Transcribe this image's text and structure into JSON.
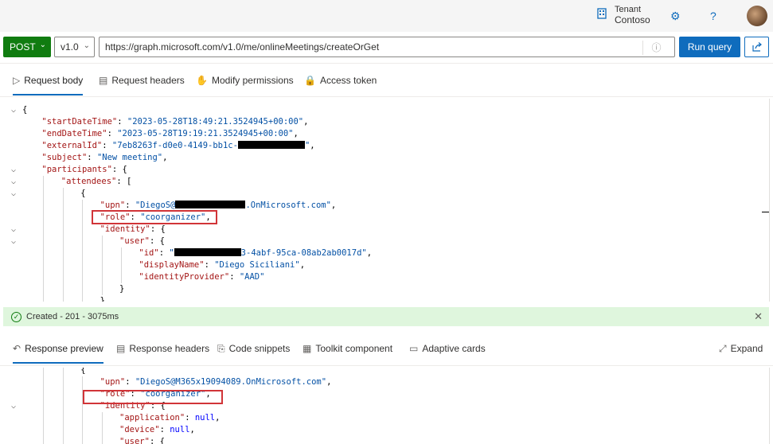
{
  "header": {
    "tenant_label": "Tenant",
    "tenant_name": "Contoso",
    "icons": [
      "building-icon",
      "gear-icon",
      "help-icon",
      "avatar"
    ]
  },
  "request": {
    "method": "POST",
    "version": "v1.0",
    "url": "https://graph.microsoft.com/v1.0/me/onlineMeetings/createOrGet",
    "run_label": "Run query"
  },
  "request_tabs": [
    {
      "label": "Request body",
      "icon": "send-icon",
      "active": true
    },
    {
      "label": "Request headers",
      "icon": "document-icon",
      "active": false
    },
    {
      "label": "Modify permissions",
      "icon": "hand-icon",
      "active": false
    },
    {
      "label": "Access token",
      "icon": "lock-icon",
      "active": false
    }
  ],
  "request_body": [
    {
      "indent": 0,
      "fold": true,
      "parts": [
        [
          "p",
          "{"
        ]
      ]
    },
    {
      "indent": 1,
      "fold": false,
      "parts": [
        [
          "k",
          "\"startDateTime\""
        ],
        [
          "p",
          ": "
        ],
        [
          "s",
          "\"2023-05-28T18:49:21.3524945+00:00\""
        ],
        [
          "p",
          ","
        ]
      ]
    },
    {
      "indent": 1,
      "fold": false,
      "parts": [
        [
          "k",
          "\"endDateTime\""
        ],
        [
          "p",
          ": "
        ],
        [
          "s",
          "\"2023-05-28T19:19:21.3524945+00:00\""
        ],
        [
          "p",
          ","
        ]
      ]
    },
    {
      "indent": 1,
      "fold": false,
      "parts": [
        [
          "k",
          "\"externalId\""
        ],
        [
          "p",
          ": "
        ],
        [
          "s",
          "\"7eb8263f-d0e0-4149-bb1c-"
        ],
        [
          "r",
          84
        ],
        [
          "s",
          "\""
        ],
        [
          "p",
          ","
        ]
      ]
    },
    {
      "indent": 1,
      "fold": false,
      "parts": [
        [
          "k",
          "\"subject\""
        ],
        [
          "p",
          ": "
        ],
        [
          "s",
          "\"New meeting\""
        ],
        [
          "p",
          ","
        ]
      ]
    },
    {
      "indent": 1,
      "fold": true,
      "parts": [
        [
          "k",
          "\"participants\""
        ],
        [
          "p",
          ": {"
        ]
      ]
    },
    {
      "indent": 2,
      "fold": true,
      "parts": [
        [
          "k",
          "\"attendees\""
        ],
        [
          "p",
          ": ["
        ]
      ]
    },
    {
      "indent": 3,
      "fold": true,
      "parts": [
        [
          "p",
          "{"
        ]
      ]
    },
    {
      "indent": 4,
      "fold": false,
      "parts": [
        [
          "k",
          "\"upn\""
        ],
        [
          "p",
          ": "
        ],
        [
          "s",
          "\"DiegoS@"
        ],
        [
          "r",
          88
        ],
        [
          "s",
          ".OnMicrosoft.com\""
        ],
        [
          "p",
          ","
        ]
      ]
    },
    {
      "indent": 4,
      "fold": false,
      "parts": [
        [
          "k",
          "\"role\""
        ],
        [
          "p",
          ": "
        ],
        [
          "s",
          "\"coorganizer\""
        ],
        [
          "p",
          ","
        ]
      ]
    },
    {
      "indent": 4,
      "fold": true,
      "parts": [
        [
          "k",
          "\"identity\""
        ],
        [
          "p",
          ": {"
        ]
      ]
    },
    {
      "indent": 5,
      "fold": true,
      "parts": [
        [
          "k",
          "\"user\""
        ],
        [
          "p",
          ": {"
        ]
      ]
    },
    {
      "indent": 6,
      "fold": false,
      "parts": [
        [
          "k",
          "\"id\""
        ],
        [
          "p",
          ": "
        ],
        [
          "s",
          "\""
        ],
        [
          "r",
          84
        ],
        [
          "s",
          "3-4abf-95ca-08ab2ab0017d\""
        ],
        [
          "p",
          ","
        ]
      ]
    },
    {
      "indent": 6,
      "fold": false,
      "parts": [
        [
          "k",
          "\"displayName\""
        ],
        [
          "p",
          ": "
        ],
        [
          "s",
          "\"Diego Siciliani\""
        ],
        [
          "p",
          ","
        ]
      ]
    },
    {
      "indent": 6,
      "fold": false,
      "parts": [
        [
          "k",
          "\"identityProvider\""
        ],
        [
          "p",
          ": "
        ],
        [
          "s",
          "\"AAD\""
        ]
      ]
    },
    {
      "indent": 5,
      "fold": false,
      "parts": [
        [
          "p",
          "}"
        ]
      ]
    },
    {
      "indent": 4,
      "fold": false,
      "parts": [
        [
          "p",
          "},"
        ]
      ]
    }
  ],
  "status": {
    "text": "Created - 201 - 3075ms",
    "color": "#dff6dd"
  },
  "response_tabs": [
    {
      "label": "Response preview",
      "icon": "undo-icon",
      "active": true
    },
    {
      "label": "Response headers",
      "icon": "document-icon",
      "active": false
    },
    {
      "label": "Code snippets",
      "icon": "code-icon",
      "active": false
    },
    {
      "label": "Toolkit component",
      "icon": "toolkit-icon",
      "active": false
    },
    {
      "label": "Adaptive cards",
      "icon": "card-icon",
      "active": false
    }
  ],
  "expand_label": "Expand",
  "response_body": [
    {
      "indent": 3,
      "fold": false,
      "parts": [
        [
          "p",
          "{"
        ]
      ]
    },
    {
      "indent": 4,
      "fold": false,
      "parts": [
        [
          "k",
          "\"upn\""
        ],
        [
          "p",
          ": "
        ],
        [
          "s",
          "\"DiegoS@M365x19094089.OnMicrosoft.com\""
        ],
        [
          "p",
          ","
        ]
      ]
    },
    {
      "indent": 4,
      "fold": false,
      "parts": [
        [
          "k",
          "\"role\""
        ],
        [
          "p",
          ": "
        ],
        [
          "s",
          "\"coorganizer\""
        ],
        [
          "p",
          ","
        ]
      ]
    },
    {
      "indent": 4,
      "fold": true,
      "parts": [
        [
          "k",
          "\"identity\""
        ],
        [
          "p",
          ": {"
        ]
      ]
    },
    {
      "indent": 5,
      "fold": false,
      "parts": [
        [
          "k",
          "\"application\""
        ],
        [
          "p",
          ": "
        ],
        [
          "kw",
          "null"
        ],
        [
          "p",
          ","
        ]
      ]
    },
    {
      "indent": 5,
      "fold": false,
      "parts": [
        [
          "k",
          "\"device\""
        ],
        [
          "p",
          ": "
        ],
        [
          "kw",
          "null"
        ],
        [
          "p",
          ","
        ]
      ]
    },
    {
      "indent": 5,
      "fold": false,
      "parts": [
        [
          "k",
          "\"user\""
        ],
        [
          "p",
          ": {"
        ]
      ]
    }
  ],
  "colors": {
    "accent": "#0f6cbd",
    "method_green": "#107c10",
    "highlight_red": "#d13438",
    "json_key": "#a31515",
    "json_string": "#0451a5"
  }
}
